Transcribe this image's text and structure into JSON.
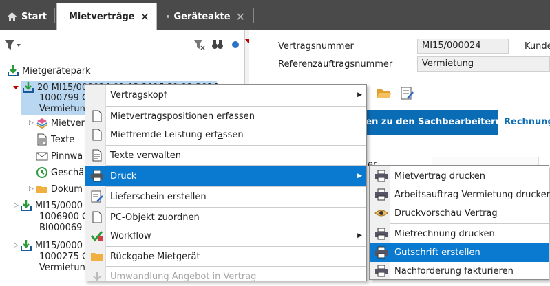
{
  "tabs": [
    {
      "label": "Start",
      "icon": "home-icon"
    },
    {
      "label": "Mietverträge",
      "icon": "home-icon",
      "close": "✕"
    },
    {
      "label": "Geräteakte",
      "icon": "document-icon",
      "close": "✕"
    }
  ],
  "tree": {
    "root": "Mietgerätepark",
    "item1_line1": "20 MI15/000024 01.03.2015 31.12.2016",
    "item1_line2": "1000799 C",
    "item1_line3": "Vermietung",
    "children": [
      "Mietver",
      "Texte",
      "Pinnwa",
      "Geschä",
      "Dokum"
    ],
    "item2_line1": "MI15/0000",
    "item2_line2": "1006900 C",
    "item2_line3": "BI000069",
    "item3_line1": "MI15/0000",
    "item3_line2": "1000275 C",
    "item3_line3": "Vermietung"
  },
  "fields": {
    "vertragsnummer_label": "Vertragsnummer",
    "vertragsnummer_value": "MI15/000024",
    "referenz_label": "Referenzauftragsnummer",
    "referenz_value": "Vermietung",
    "kunde_label": "Kunde",
    "tab_sachbearbeiter": "ben zu den Sachbearbeitern",
    "tab_rechnung": "Rechnung",
    "partial_label": "er"
  },
  "context_menu": [
    {
      "label": "Vertragskopf",
      "submenu": true
    },
    {
      "label": "Mietvertragspositionen erfassen"
    },
    {
      "label": "Mietfremde Leistung erfassen"
    },
    {
      "label": "Texte verwalten"
    },
    {
      "label": "Druck",
      "submenu": true,
      "highlighted": true
    },
    {
      "label": "Lieferschein erstellen"
    },
    {
      "label": "PC-Objekt zuordnen"
    },
    {
      "label": "Workflow",
      "submenu": true
    },
    {
      "label": "Rückgabe Mietgerät"
    },
    {
      "label": "Umwandlung Angebot in Vertrag",
      "disabled": true
    }
  ],
  "submenu": [
    {
      "label": "Mietvertrag drucken"
    },
    {
      "label": "Arbeitsauftrag Vermietung drucken"
    },
    {
      "label": "Druckvorschau Vertrag"
    },
    {
      "label": "Mietrechnung drucken"
    },
    {
      "label": "Gutschrift erstellen",
      "highlighted": true
    },
    {
      "label": "Nachforderung fakturieren"
    }
  ],
  "colors": {
    "accent": "#0a7ad0",
    "tabbar": "#4a4a4a",
    "selection": "#b9d7f0"
  }
}
